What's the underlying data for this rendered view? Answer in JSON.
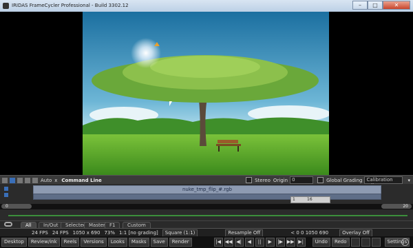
{
  "window": {
    "title": "IRIDAS FrameCycler Professional - Build 3302.12",
    "minimize": "–",
    "maximize": "□",
    "close": "✕"
  },
  "cmdbar": {
    "auto": "Auto",
    "x": "x",
    "command_line": "Command Line",
    "stereo": "Stereo",
    "origin_label": "Origin",
    "origin_value": "0",
    "global_grading": "Global Grading",
    "calibration": "Calibration Off"
  },
  "timeline": {
    "clip_name": "nuke_tmp_flip_#.rgb",
    "range_start": "1",
    "range_end": "16",
    "start_frame": "0",
    "end_frame": "20"
  },
  "tabs": [
    "All",
    "In/Out",
    "Selected",
    "Master",
    "F1",
    "Custom"
  ],
  "status": {
    "fps_set": "24 FPS",
    "fps_actual": "24 FPS",
    "resolution": "1050 x 690",
    "zoom": "73%",
    "grading": "1:1 [no grading]",
    "aspect": "Square (1:1)",
    "resample": "Resample Off",
    "coords": "< 0 0 1050 690",
    "overlay": "Overlay Off"
  },
  "bottom_left_buttons": [
    "Desktop",
    "Review/ink",
    "Reels",
    "Versions",
    "Looks",
    "Masks",
    "Save",
    "Render"
  ],
  "bottom_right_buttons": [
    "Undo",
    "Redo"
  ],
  "settings": "Settings",
  "transport": [
    "|◀",
    "◀◀",
    "◀|",
    "◀",
    "||",
    "▶",
    "|▶",
    "▶▶",
    "▶|"
  ]
}
